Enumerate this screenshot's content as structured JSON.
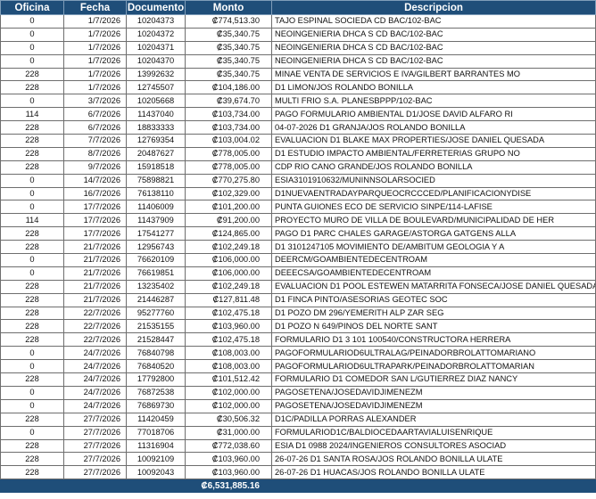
{
  "columns": [
    "Oficina",
    "Fecha",
    "Documento",
    "Monto",
    "Descripcion"
  ],
  "rows": [
    [
      "0",
      "1/7/2026",
      "10204373",
      "₡774,513.30",
      "TAJO ESPINAL SOCIEDA CD BAC/102-BAC"
    ],
    [
      "0",
      "1/7/2026",
      "10204372",
      "₡35,340.75",
      "NEOINGENIERIA DHCA S CD BAC/102-BAC"
    ],
    [
      "0",
      "1/7/2026",
      "10204371",
      "₡35,340.75",
      "NEOINGENIERIA DHCA S CD BAC/102-BAC"
    ],
    [
      "0",
      "1/7/2026",
      "10204370",
      "₡35,340.75",
      "NEOINGENIERIA DHCA S CD BAC/102-BAC"
    ],
    [
      "228",
      "1/7/2026",
      "13992632",
      "₡35,340.75",
      "MINAE VENTA DE SERVICIOS E IVA/GILBERT BARRANTES MO"
    ],
    [
      "228",
      "1/7/2026",
      "12745507",
      "₡104,186.00",
      "D1 LIMON/JOS ROLANDO BONILLA"
    ],
    [
      "0",
      "3/7/2026",
      "10205668",
      "₡39,674.70",
      "MULTI FRIO S.A. PLANESBPPP/102-BAC"
    ],
    [
      "114",
      "6/7/2026",
      "11437040",
      "₡103,734.00",
      "PAGO FORMULARIO AMBIENTAL D1/JOSE DAVID ALFARO RI"
    ],
    [
      "228",
      "6/7/2026",
      "18833333",
      "₡103,734.00",
      "04-07-2026 D1 GRANJA/JOS ROLANDO BONILLA"
    ],
    [
      "228",
      "7/7/2026",
      "12769354",
      "₡103,004.02",
      "EVALUACION D1 BLAKE MAX PROPERTIES/JOSE DANIEL QUESADA"
    ],
    [
      "228",
      "8/7/2026",
      "20487627",
      "₡778,005.00",
      "D1 ESTUDIO IMPACTO AMBIENTAL/FERRETERIAS GRUPO NO"
    ],
    [
      "228",
      "9/7/2026",
      "15918518",
      "₡778,005.00",
      "CDP RIO CANO GRANDE/JOS ROLANDO BONILLA"
    ],
    [
      "0",
      "14/7/2026",
      "75898821",
      "₡770,275.80",
      "ESIA3101910632/MUNINNSOLARSOCIED"
    ],
    [
      "0",
      "16/7/2026",
      "76138110",
      "₡102,329.00",
      "D1NUEVAENTRADAYPARQUEOCRCCCED/PLANIFICACIONYDISE"
    ],
    [
      "0",
      "17/7/2026",
      "11406009",
      "₡101,200.00",
      "PUNTA GUIONES ECO DE SERVICIO SINPE/114-LAFISE"
    ],
    [
      "114",
      "17/7/2026",
      "11437909",
      "₡91,200.00",
      "PROYECTO MURO DE VILLA DE BOULEVARD/MUNICIPALIDAD DE HER"
    ],
    [
      "228",
      "17/7/2026",
      "17541277",
      "₡124,865.00",
      "PAGO D1 PARC CHALES GARAGE/ASTORGA GATGENS ALLA"
    ],
    [
      "228",
      "21/7/2026",
      "12956743",
      "₡102,249.18",
      "D1 3101247105 MOVIMIENTO DE/AMBITUM GEOLOGIA Y A"
    ],
    [
      "0",
      "21/7/2026",
      "76620109",
      "₡106,000.00",
      "DEERCM/GOAMBIENTEDECENTROAM"
    ],
    [
      "0",
      "21/7/2026",
      "76619851",
      "₡106,000.00",
      "DEEECSA/GOAMBIENTEDECENTROAM"
    ],
    [
      "228",
      "21/7/2026",
      "13235402",
      "₡102,249.18",
      "EVALUACION D1 POOL ESTEWEN MATARRITA FONSECA/JOSE DANIEL QUESADA"
    ],
    [
      "228",
      "21/7/2026",
      "21446287",
      "₡127,811.48",
      "D1 FINCA PINTO/ASESORIAS GEOTEC SOC"
    ],
    [
      "228",
      "22/7/2026",
      "95277760",
      "₡102,475.18",
      "D1 POZO DM 296/YEMERITH ALP ZAR SEG"
    ],
    [
      "228",
      "22/7/2026",
      "21535155",
      "₡103,960.00",
      "D1 POZO N 649/PINOS DEL NORTE SANT"
    ],
    [
      "228",
      "22/7/2026",
      "21528447",
      "₡102,475.18",
      "FORMULARIO D1 3 101 100540/CONSTRUCTORA HERRERA"
    ],
    [
      "0",
      "24/7/2026",
      "76840798",
      "₡108,003.00",
      "PAGOFORMULARIOD6ULTRALAG/PEINADORBROLATTOMARIANO"
    ],
    [
      "0",
      "24/7/2026",
      "76840520",
      "₡108,003.00",
      "PAGOFORMULARIOD6ULTRAPARK/PEINADORBROLATTOMARIAN"
    ],
    [
      "228",
      "24/7/2026",
      "17792800",
      "₡101,512.42",
      "FORMULARIO D1 COMEDOR SAN L/GUTIERREZ DIAZ NANCY"
    ],
    [
      "0",
      "24/7/2026",
      "76872538",
      "₡102,000.00",
      "PAGOSETENA/JOSEDAVIDJIMENEZM"
    ],
    [
      "0",
      "24/7/2026",
      "76869730",
      "₡102,000.00",
      "PAGOSETENA/JOSEDAVIDJIMENEZM"
    ],
    [
      "228",
      "27/7/2026",
      "11420459",
      "₡30,506.32",
      "D1C/PADILLA PORRAS ALEXANDER"
    ],
    [
      "0",
      "27/7/2026",
      "77018706",
      "₡31,000.00",
      "FORMULARIOD1C/BALDIOCEDAARTAVIALUISENRIQUE"
    ],
    [
      "228",
      "27/7/2026",
      "11316904",
      "₡772,038.60",
      "ESIA D1 0988 2024/INGENIEROS CONSULTORES ASOCIAD"
    ],
    [
      "228",
      "27/7/2026",
      "10092109",
      "₡103,960.00",
      "26-07-26 D1 SANTA ROSA/JOS ROLANDO BONILLA ULATE"
    ],
    [
      "228",
      "27/7/2026",
      "10092043",
      "₡103,960.00",
      "26-07-26 D1 HUACAS/JOS ROLANDO BONILLA ULATE"
    ]
  ],
  "total": "₡6,531,885.16",
  "colors": {
    "header_bg": "#1f4e79",
    "header_text": "#ffffff"
  }
}
